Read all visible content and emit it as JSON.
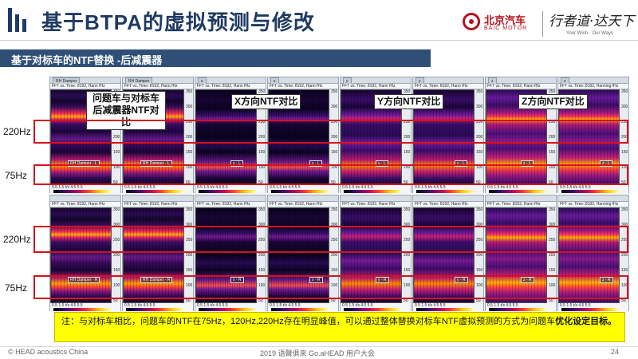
{
  "header": {
    "title": "基于BTPA的虚拟预测与修改",
    "brand_cn": "北京汽车",
    "brand_en": "BAIC MOTOR",
    "slogan_cn": "行者道·达天下",
    "slogan_en": "Your Wish · Our Ways"
  },
  "section": {
    "label": "基于对标车的NTF替换 -后减震器"
  },
  "callouts": {
    "compare": "问题车与对标车\n后减震器NTF对比",
    "x": "X方向NTF对比",
    "y": "Y方向NTF对比",
    "z": "Z方向NTF对比"
  },
  "band_labels": {
    "top_220": "220Hz",
    "top_75": "75Hz",
    "bottom_220": "220Hz",
    "bottom_75": "75Hz"
  },
  "panel_common": {
    "fft_label": "FFT vs. Time: 8192, Hann fHz",
    "fft_label_alt": "FFT vs. Time: 8192, Hanning fHz",
    "x_ticks": "0.5  1.5    t/s      4.5 5.5",
    "cbar_label": "15   LinBIA[SPL]    60",
    "y_ticks": [
      "350",
      "300",
      "250",
      "200",
      "150",
      "100",
      "50"
    ]
  },
  "panels_top": [
    {
      "tab": "RH Damper",
      "inlabel": "RH Damper - L",
      "style": ""
    },
    {
      "tab": "RH Damper",
      "inlabel": "RH Damper - L",
      "style": ""
    },
    {
      "tab": "x",
      "inlabel": "x - L",
      "style": "x"
    },
    {
      "tab": "x",
      "inlabel": "x - L",
      "style": "x"
    },
    {
      "tab": "y",
      "inlabel": "y - L",
      "style": "y"
    },
    {
      "tab": "y",
      "inlabel": "y - L",
      "style": "y"
    },
    {
      "tab": "z",
      "inlabel": "z - L",
      "style": "z"
    },
    {
      "tab": "z",
      "inlabel": "z - L",
      "style": "z"
    }
  ],
  "panels_bottom": [
    {
      "inlabel": "RH Damper - R",
      "style": ""
    },
    {
      "inlabel": "RH Damper - R",
      "style": ""
    },
    {
      "inlabel": "x - R",
      "style": "x"
    },
    {
      "inlabel": "x - R",
      "style": "x"
    },
    {
      "inlabel": "y - R",
      "style": "y"
    },
    {
      "inlabel": "y - R",
      "style": "y"
    },
    {
      "inlabel": "z - R",
      "style": "z"
    },
    {
      "inlabel": "z - R",
      "style": "z"
    }
  ],
  "note": {
    "text": "注：与对标车相比，问题车的NTF在75Hz，120Hz,220Hz存在明显峰值，可以通过整体替换对标车NTF虚拟预测的方式为问题车",
    "bold": "优化设定目标。"
  },
  "footer": {
    "left": "© HEAD acoustics China",
    "center": "2019 语聲俱來 Go.aHEAD 用户大会",
    "page": "24"
  },
  "colors": {
    "title": "#1f3a63",
    "section_bar": "#2f4f77",
    "band_border": "#d6121b",
    "note_bg": "#ffff00",
    "brand_red": "#b5121b"
  }
}
